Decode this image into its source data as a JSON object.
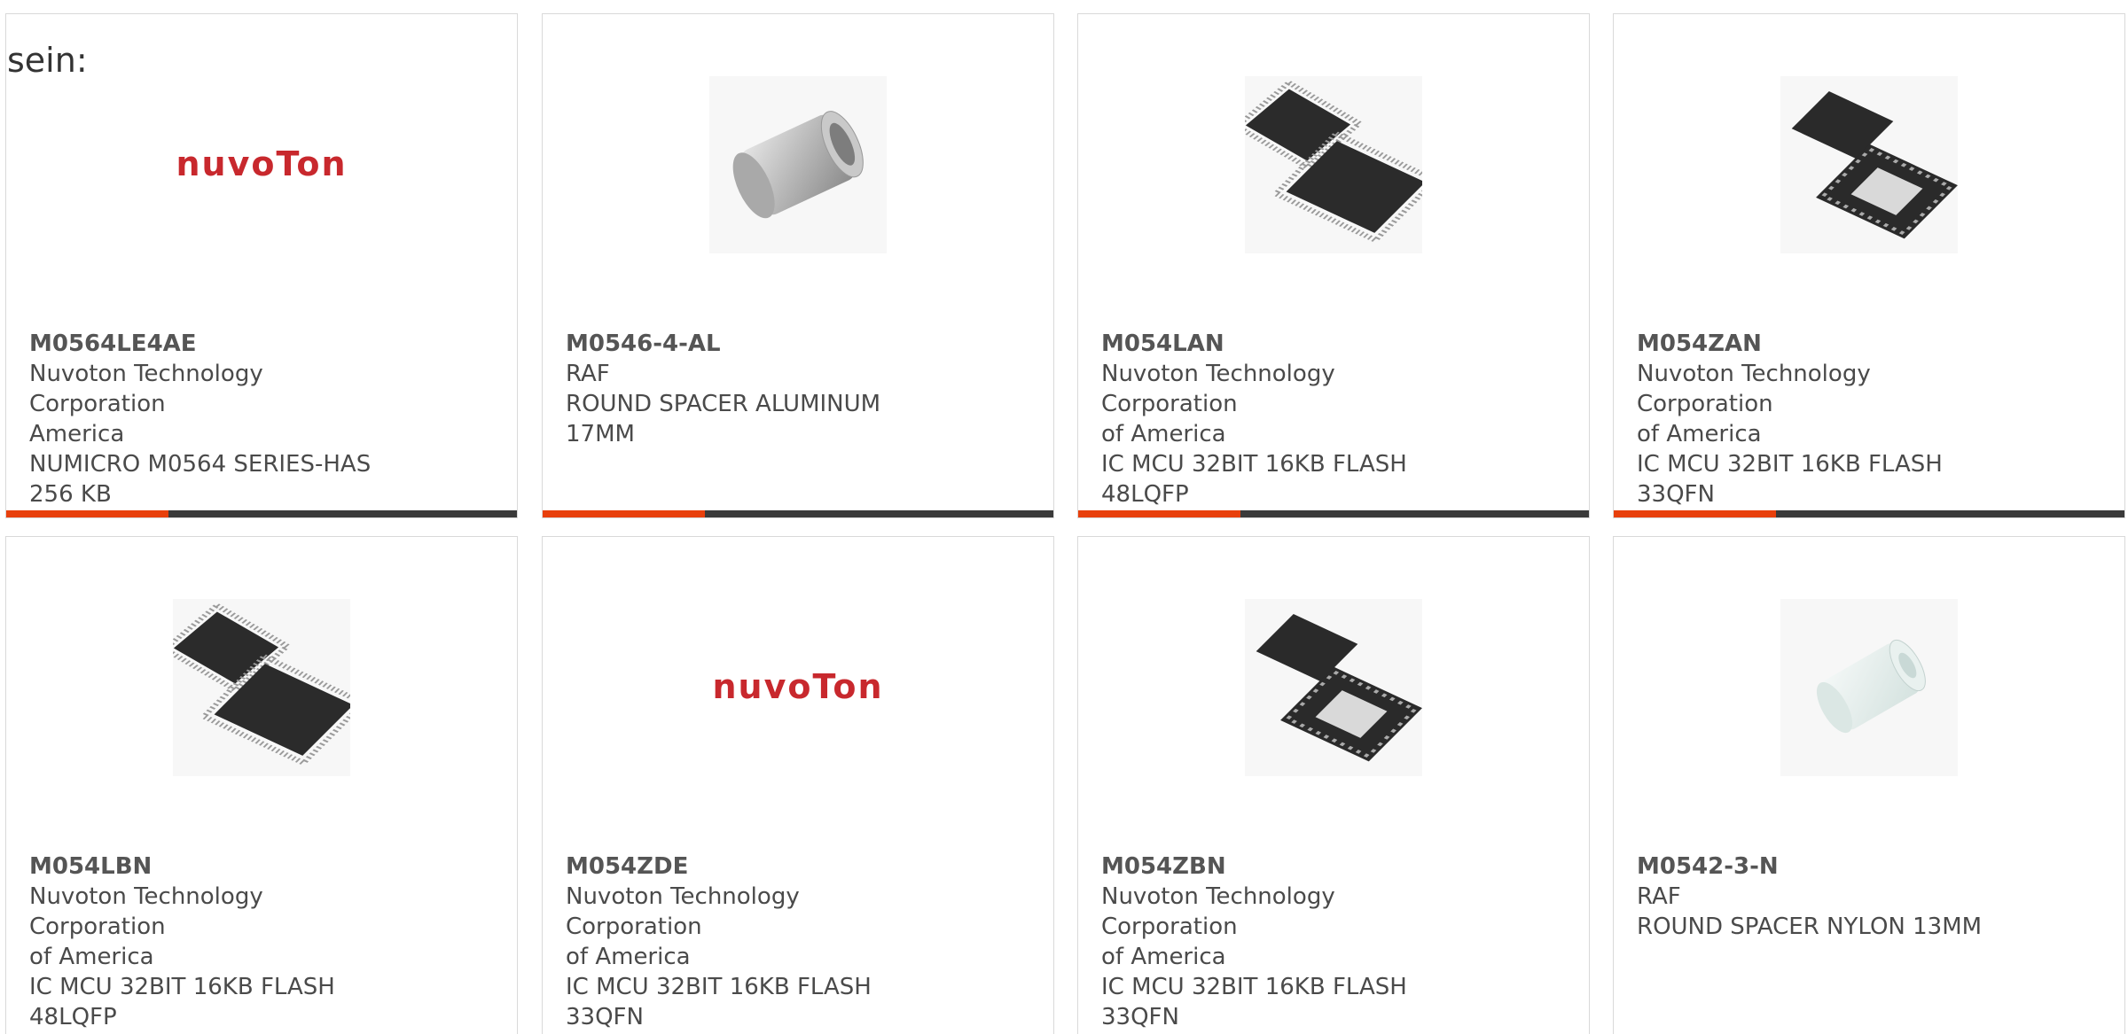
{
  "intro_text": "sein:",
  "colors": {
    "accent": "#e8400c",
    "bar_dark": "#3a3a3a",
    "brand_red": "#c8282d"
  },
  "products": [
    {
      "part": "M0564LE4AE",
      "manufacturer": "Nuvoton Technology Corporation\nAmerica",
      "description": "NUMICRO M0564 SERIES-HAS\n256 KB",
      "image": "nuvoton-logo",
      "logo_text": "nuvoTon"
    },
    {
      "part": "M0546-4-AL",
      "manufacturer": "RAF",
      "description": "ROUND SPACER ALUMINUM\n17MM",
      "image": "aluminum-spacer"
    },
    {
      "part": "M054LAN",
      "manufacturer": "Nuvoton Technology Corporation\nof America",
      "description": "IC MCU 32BIT 16KB FLASH\n48LQFP",
      "image": "lqfp-chip"
    },
    {
      "part": "M054ZAN",
      "manufacturer": "Nuvoton Technology Corporation\nof America",
      "description": "IC MCU 32BIT 16KB FLASH\n33QFN",
      "image": "qfn-chip"
    },
    {
      "part": "M054LBN",
      "manufacturer": "Nuvoton Technology Corporation\nof America",
      "description": "IC MCU 32BIT 16KB FLASH\n48LQFP",
      "image": "lqfp-chip"
    },
    {
      "part": "M054ZDE",
      "manufacturer": "Nuvoton Technology Corporation\nof America",
      "description": "IC MCU 32BIT 16KB FLASH\n33QFN",
      "image": "nuvoton-logo",
      "logo_text": "nuvoTon"
    },
    {
      "part": "M054ZBN",
      "manufacturer": "Nuvoton Technology Corporation\nof America",
      "description": "IC MCU 32BIT 16KB FLASH\n33QFN",
      "image": "qfn-chip"
    },
    {
      "part": "M0542-3-N",
      "manufacturer": "RAF",
      "description": "ROUND SPACER NYLON 13MM",
      "image": "nylon-spacer"
    }
  ]
}
